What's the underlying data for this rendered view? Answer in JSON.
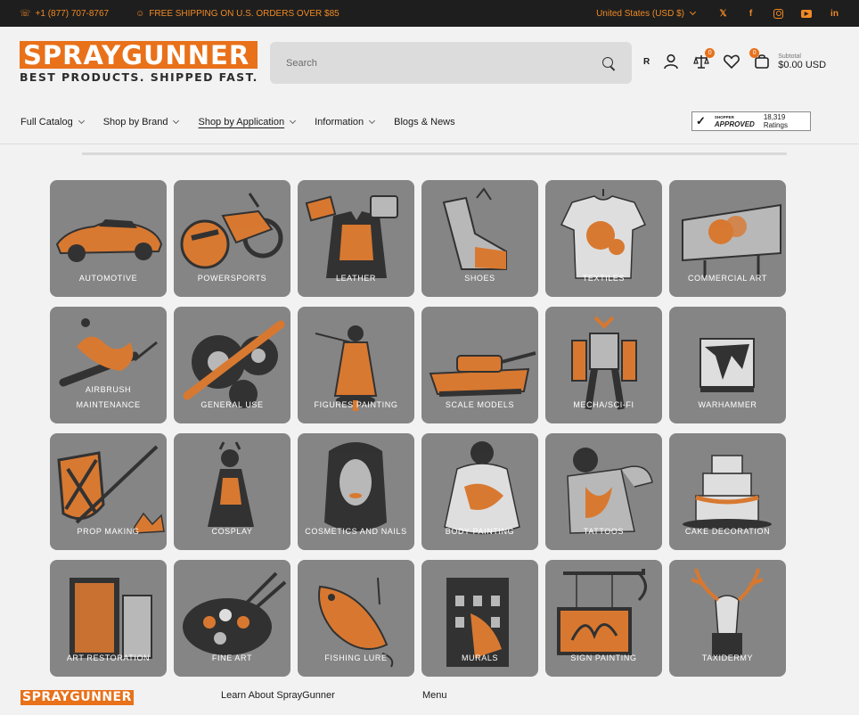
{
  "topbar": {
    "phone": "+1 (877) 707-8767",
    "shipping": "FREE SHIPPING ON U.S. ORDERS OVER $85",
    "currency": "United States (USD $)"
  },
  "header": {
    "logo_main": "SPRAYGUNNER",
    "logo_sub": "BEST PRODUCTS. SHIPPED FAST.",
    "search_placeholder": "Search",
    "r_label": "R",
    "compare_count": "0",
    "cart_count": "0",
    "subtotal_label": "Subtotal",
    "subtotal_amount": "$0.00 USD"
  },
  "nav": {
    "items": [
      {
        "label": "Full Catalog"
      },
      {
        "label": "Shop by Brand"
      },
      {
        "label": "Shop by Application"
      },
      {
        "label": "Information"
      },
      {
        "label": "Blogs & News"
      }
    ],
    "shopper_small": "SHOPPER",
    "shopper_big": "APPROVED",
    "ratings": "18,319 Ratings"
  },
  "tiles": [
    "AUTOMOTIVE",
    "POWERSPORTS",
    "LEATHER",
    "SHOES",
    "TEXTILES",
    "COMMERCIAL ART",
    "AIRBRUSH MAINTENANCE",
    "GENERAL USE",
    "FIGURES PAINTING",
    "SCALE MODELS",
    "MECHA/SCI-FI",
    "WARHAMMER",
    "PROP MAKING",
    "COSPLAY",
    "COSMETICS AND NAILS",
    "BODY PAINTING",
    "TATTOOS",
    "CAKE DECORATION",
    "ART RESTORATION",
    "FINE ART",
    "FISHING LURE",
    "MURALS",
    "SIGN PAINTING",
    "TAXIDERMY"
  ],
  "colors": {
    "accent": "#e8711a",
    "tile": "#858585",
    "topbar": "#1e1e1e"
  },
  "footer": {
    "logo": "SPRAYGUNNER",
    "learn": "Learn About SprayGunner",
    "menu": "Menu"
  }
}
